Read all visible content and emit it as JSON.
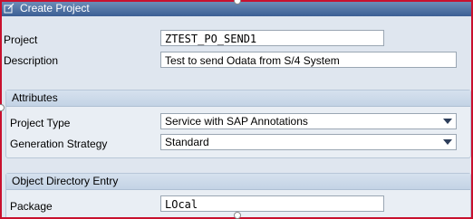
{
  "window": {
    "title": "Create Project"
  },
  "fields": {
    "project": {
      "label": "Project",
      "value": "ZTEST_PO_SEND1"
    },
    "description": {
      "label": "Description",
      "value": "Test to send Odata from S/4 System"
    }
  },
  "attributes": {
    "title": "Attributes",
    "project_type": {
      "label": "Project Type",
      "value": "Service with SAP Annotations"
    },
    "generation_strategy": {
      "label": "Generation Strategy",
      "value": "Standard"
    }
  },
  "object_directory": {
    "title": "Object Directory Entry",
    "package": {
      "label": "Package",
      "value": "LOcal"
    }
  },
  "colors": {
    "title_bar": "#4b6fa3",
    "frame_border": "#c8102e",
    "group_header": "#c9d8e8"
  }
}
